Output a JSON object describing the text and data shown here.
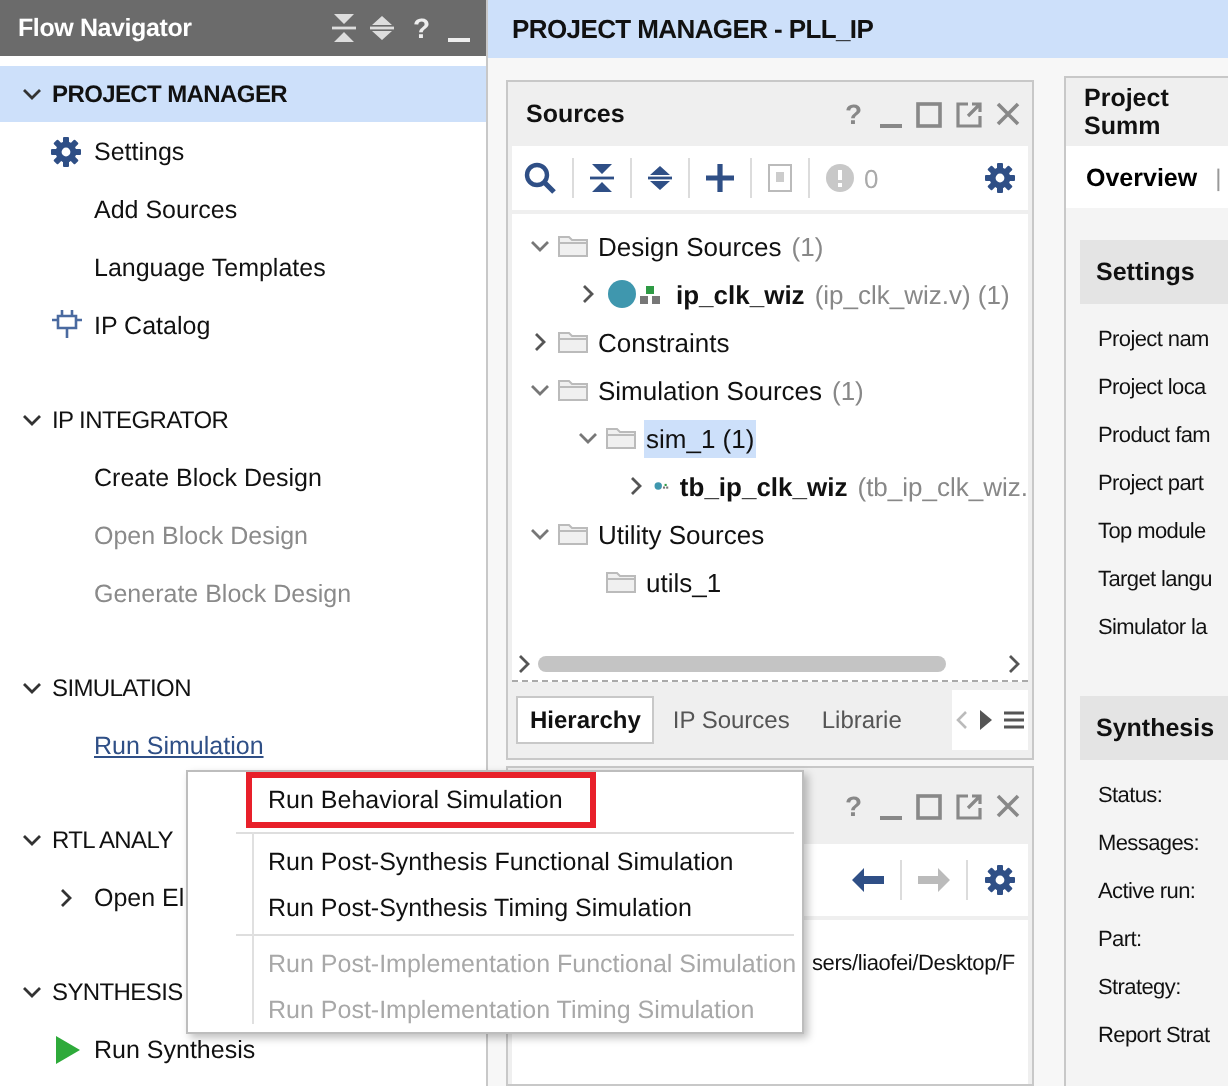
{
  "flow_navigator": {
    "title": "Flow Navigator",
    "help": "?",
    "sections": [
      {
        "title": "PROJECT MANAGER",
        "selected": true,
        "expanded": true,
        "items": [
          {
            "label": "Settings",
            "kind": "settings",
            "disabled": false,
            "hovered": false
          },
          {
            "label": "Add Sources",
            "kind": "plain",
            "disabled": false,
            "hovered": false
          },
          {
            "label": "Language Templates",
            "kind": "plain",
            "disabled": false,
            "hovered": false
          },
          {
            "label": "IP Catalog",
            "kind": "catalog",
            "disabled": false,
            "hovered": false
          }
        ]
      },
      {
        "title": "IP INTEGRATOR",
        "selected": false,
        "expanded": true,
        "items": [
          {
            "label": "Create Block Design",
            "kind": "plain",
            "disabled": false,
            "hovered": false
          },
          {
            "label": "Open Block Design",
            "kind": "plain",
            "disabled": true,
            "hovered": false
          },
          {
            "label": "Generate Block Design",
            "kind": "plain",
            "disabled": true,
            "hovered": false
          }
        ]
      },
      {
        "title": "SIMULATION",
        "selected": false,
        "expanded": true,
        "items": [
          {
            "label": "Run Simulation",
            "kind": "plain",
            "disabled": false,
            "hovered": true
          }
        ]
      },
      {
        "title": "RTL ANALY",
        "selected": false,
        "expanded": true,
        "items": [
          {
            "label": "Open El",
            "kind": "expander",
            "expanded": false,
            "disabled": false,
            "hovered": false
          }
        ]
      },
      {
        "title": "SYNTHESIS",
        "selected": false,
        "expanded": true,
        "items": [
          {
            "label": "Run Synthesis",
            "kind": "run",
            "disabled": false,
            "hovered": false
          }
        ]
      }
    ]
  },
  "main": {
    "title": "PROJECT MANAGER - PLL_IP"
  },
  "sources": {
    "title": "Sources",
    "help": "?",
    "issue_count": "0",
    "tree": [
      {
        "label": "Design Sources",
        "count": "(1)",
        "kind": "folder",
        "expanded": true,
        "selected": false,
        "children": [
          {
            "label": "ip_clk_wiz",
            "detail": "(ip_clk_wiz.v) (1)",
            "kind": "module",
            "expanded": false,
            "selected": false
          }
        ]
      },
      {
        "label": "Constraints",
        "kind": "folder",
        "expanded": false,
        "selected": false
      },
      {
        "label": "Simulation Sources",
        "count": "(1)",
        "kind": "folder",
        "expanded": true,
        "selected": false,
        "children": [
          {
            "label": "sim_1 (1)",
            "kind": "folder",
            "expanded": true,
            "selected": true,
            "children": [
              {
                "label": "tb_ip_clk_wiz",
                "detail": "(tb_ip_clk_wiz.",
                "kind": "module",
                "expanded": false,
                "selected": false
              }
            ]
          }
        ]
      },
      {
        "label": "Utility Sources",
        "kind": "folder",
        "expanded": true,
        "selected": false,
        "children": [
          {
            "label": "utils_1",
            "kind": "folder",
            "selected": false
          }
        ]
      }
    ],
    "tabs": [
      {
        "label": "Hierarchy",
        "selected": true
      },
      {
        "label": "IP Sources",
        "selected": false
      },
      {
        "label": "Librarie",
        "selected": false
      }
    ]
  },
  "console_panel": {
    "help": "?",
    "text": "sers/liaofei/Desktop/F"
  },
  "summary": {
    "title": "Project Summ",
    "tabs": [
      {
        "label": "Overview",
        "selected": true
      }
    ],
    "divider": "|",
    "sections": [
      {
        "title": "Settings",
        "rows": [
          "Project nam",
          "Project loca",
          "Product fam",
          "Project part",
          "Top module",
          "Target langu",
          "Simulator la"
        ]
      },
      {
        "title": "Synthesis",
        "rows": [
          "Status:",
          "Messages:",
          "Active run:",
          "Part:",
          "Strategy:",
          "Report Strat"
        ]
      }
    ]
  },
  "context_menu": {
    "items": [
      {
        "kind": "item",
        "label": "Run Behavioral Simulation",
        "disabled": false,
        "highlighted": true
      },
      {
        "kind": "separator"
      },
      {
        "kind": "item",
        "label": "Run Post-Synthesis Functional Simulation",
        "disabled": false,
        "highlighted": false
      },
      {
        "kind": "item",
        "label": "Run Post-Synthesis Timing Simulation",
        "disabled": false,
        "highlighted": false
      },
      {
        "kind": "separator"
      },
      {
        "kind": "item",
        "label": "Run Post-Implementation Functional Simulation",
        "disabled": true,
        "highlighted": false
      },
      {
        "kind": "item",
        "label": "Run Post-Implementation Timing Simulation",
        "disabled": true,
        "highlighted": false
      }
    ]
  }
}
